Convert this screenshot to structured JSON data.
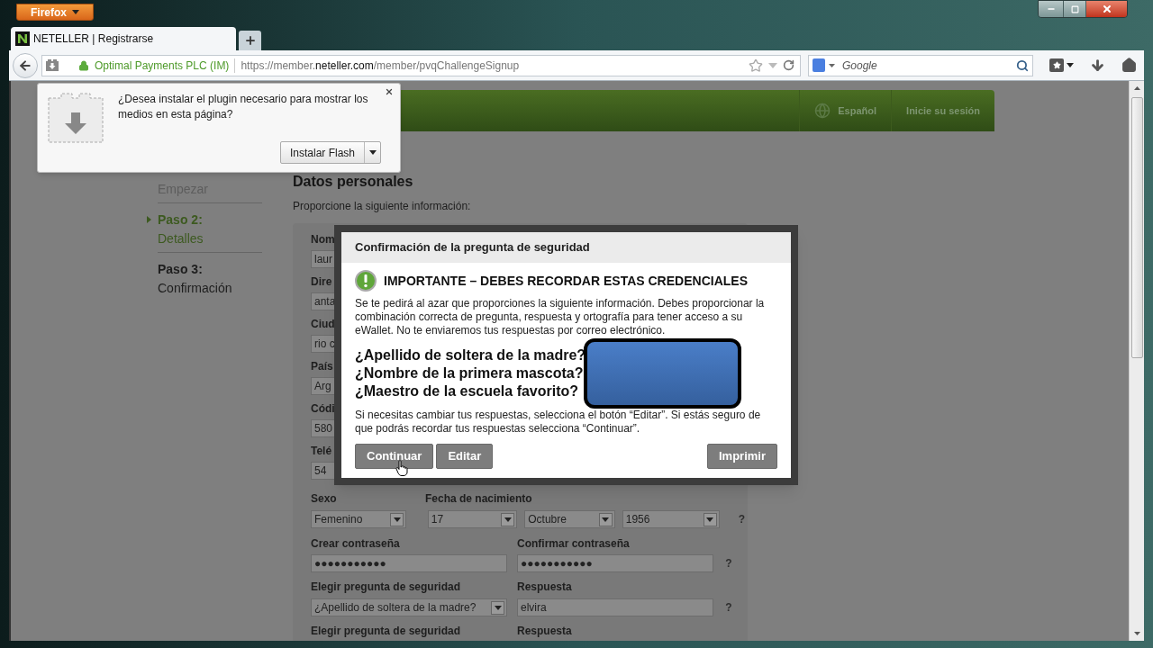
{
  "browser": {
    "menu_button": "Firefox",
    "tabs": [
      {
        "title": "NETELLER | Registrarse",
        "selected": true
      }
    ],
    "identity": "Optimal Payments PLC (IM)",
    "url": {
      "prefix": "https://member.",
      "domain": "neteller.com",
      "path": "/member/pvqChallengeSignup"
    },
    "search": {
      "placeholder": "Google"
    }
  },
  "plugin_prompt": {
    "message": "¿Desea instalar el plugin necesario para mostrar los medios en esta página?",
    "button": "Instalar Flash"
  },
  "header": {
    "language": "Español",
    "login": "Inicie su sesión"
  },
  "steps": [
    {
      "name": "Empezar",
      "done": true,
      "selected": false
    },
    {
      "title": "Paso 2:",
      "name": "Detalles",
      "done": false,
      "selected": true
    },
    {
      "title": "Paso 3:",
      "name": "Confirmación",
      "done": false,
      "selected": false
    }
  ],
  "form": {
    "title": "Datos personales",
    "subtitle": "Proporcione la siguiente información:",
    "partial_fields": [
      {
        "label": "Nom",
        "value": "laur"
      },
      {
        "label": "Dire",
        "value": "anta"
      },
      {
        "label": "Ciud",
        "value": "rio c"
      },
      {
        "label": "País",
        "value": "Arg"
      },
      {
        "label": "Códi",
        "value": "580"
      },
      {
        "label": "Telé",
        "value": "54"
      }
    ],
    "birth": {
      "sex_label": "Sexo",
      "date_label": "Fecha de nacimiento",
      "sex": "Femenino",
      "day": "17",
      "month": "Octubre",
      "year": "1956",
      "help": "?"
    },
    "password": {
      "label": "Crear contraseña",
      "value": "●●●●●●●●●●●",
      "confirm_label": "Confirmar contraseña",
      "confirm_value": "●●●●●●●●●●●",
      "help": "?"
    },
    "security": [
      {
        "question_label": "Elegir pregunta de seguridad",
        "question": "¿Apellido de soltera de la madre?",
        "answer_label": "Respuesta",
        "answer": "elvira",
        "help": "?"
      },
      {
        "question_label": "Elegir pregunta de seguridad",
        "answer_label": "Respuesta"
      }
    ]
  },
  "modal": {
    "title": "Confirmación de la pregunta de seguridad",
    "heading": "IMPORTANTE – DEBES RECORDAR ESTAS CREDENCIALES",
    "body": "Se te pedirá al azar que proporciones la siguiente información. Debes proporcionar la combinación correcta de pregunta, respuesta y ortografía para tener acceso a su eWallet. No te enviaremos tus respuestas por correo electrónico.",
    "questions": [
      "¿Apellido de soltera de la madre?",
      "¿Nombre de la primera mascota?",
      "¿Maestro de la escuela favorito?"
    ],
    "note": "Si necesitas cambiar tus respuestas, selecciona el botón “Editar”. Si estás seguro de que podrás recordar tus respuestas selecciona “Continuar”.",
    "buttons": [
      "Continuar",
      "Editar"
    ],
    "print_button": "Imprimir"
  }
}
